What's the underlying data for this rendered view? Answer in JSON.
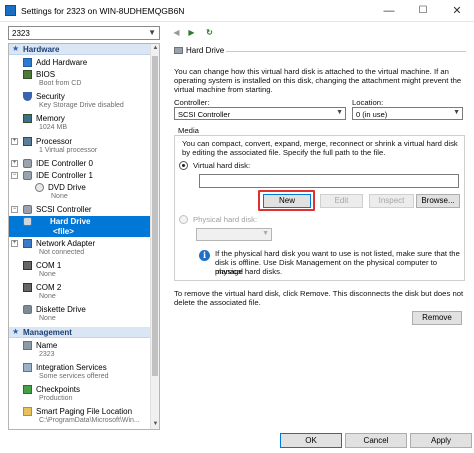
{
  "window": {
    "title": "Settings for 2323 on WIN-8UDHEMQGB6N",
    "minimize": "—",
    "maximize": "☐",
    "close": "✕"
  },
  "vm_selector": {
    "value": "2323"
  },
  "nav": {
    "back": "◀",
    "forward": "▶",
    "refresh": "↻"
  },
  "sidebar": {
    "hardware_header": "Hardware",
    "management_header": "Management",
    "items": [
      {
        "label": "Add Hardware",
        "sub": ""
      },
      {
        "label": "BIOS",
        "sub": "Boot from CD"
      },
      {
        "label": "Security",
        "sub": "Key Storage Drive disabled"
      },
      {
        "label": "Memory",
        "sub": "1024 MB"
      },
      {
        "label": "Processor",
        "sub": "1 Virtual processor"
      },
      {
        "label": "IDE Controller 0",
        "sub": ""
      },
      {
        "label": "IDE Controller 1",
        "sub": ""
      },
      {
        "label": "DVD Drive",
        "sub": "None"
      },
      {
        "label": "SCSI Controller",
        "sub": ""
      },
      {
        "label": "Hard Drive",
        "sub": "<file>"
      },
      {
        "label": "Network Adapter",
        "sub": "Not connected"
      },
      {
        "label": "COM 1",
        "sub": "None"
      },
      {
        "label": "COM 2",
        "sub": "None"
      },
      {
        "label": "Diskette Drive",
        "sub": "None"
      }
    ],
    "mgmt_items": [
      {
        "label": "Name",
        "sub": "2323"
      },
      {
        "label": "Integration Services",
        "sub": "Some services offered"
      },
      {
        "label": "Checkpoints",
        "sub": "Production"
      },
      {
        "label": "Smart Paging File Location",
        "sub": "C:\\ProgramData\\Microsoft\\Win..."
      }
    ]
  },
  "panel": {
    "title": "Hard Drive",
    "intro": [
      "You can change how this virtual hard disk is attached to the virtual machine. If an",
      "operating system is installed on this disk, changing the attachment might prevent the",
      "virtual machine from starting."
    ],
    "controller_label": "Controller:",
    "controller_value": "SCSI Controller",
    "location_label": "Location:",
    "location_value": "0 (in use)",
    "media_label": "Media",
    "media_text": [
      "You can compact, convert, expand, merge, reconnect or shrink a virtual hard disk",
      "by editing the associated file. Specify the full path to the file."
    ],
    "virtual_hd_label": "Virtual hard disk:",
    "virtual_hd_value": "",
    "btn_new": "New",
    "btn_edit": "Edit",
    "btn_inspect": "Inspect",
    "btn_browse": "Browse...",
    "physical_hd_label": "Physical hard disk:",
    "physical_note": [
      "If the physical hard disk you want to use is not listed, make sure that the",
      "disk is offline. Use Disk Management on the physical computer to manage",
      "physical hard disks."
    ],
    "remove_text": [
      "To remove the virtual hard disk, click Remove. This disconnects the disk but does not",
      "delete the associated file."
    ],
    "btn_remove": "Remove"
  },
  "footer": {
    "ok": "OK",
    "cancel": "Cancel",
    "apply": "Apply"
  },
  "colors": {
    "accent": "#0078d7",
    "highlight": "#e03131",
    "section_bg": "#dbe6f4"
  }
}
